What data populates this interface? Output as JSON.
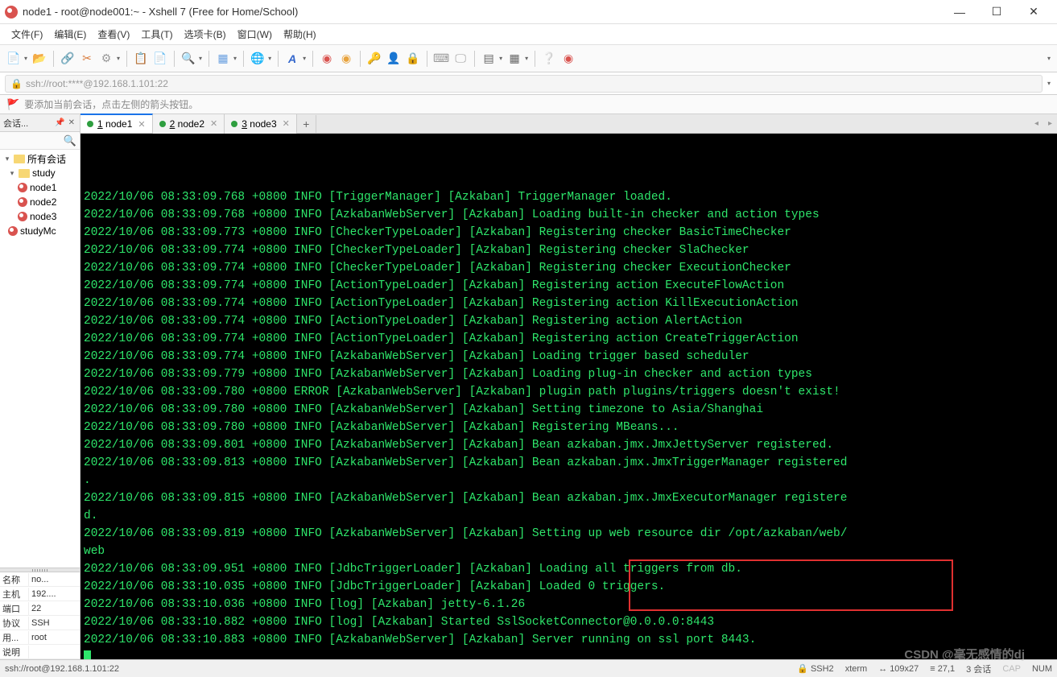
{
  "window": {
    "title": "node1 - root@node001:~ - Xshell 7 (Free for Home/School)"
  },
  "menu": {
    "file": "文件(F)",
    "edit": "编辑(E)",
    "view": "查看(V)",
    "tools": "工具(T)",
    "tabs": "选项卡(B)",
    "window": "窗口(W)",
    "help": "帮助(H)"
  },
  "address": {
    "url": "ssh://root:****@192.168.1.101:22"
  },
  "hint": {
    "text": "要添加当前会话，点击左侧的箭头按钮。"
  },
  "sidepanel": {
    "title": "会话...",
    "tree": {
      "root": "所有会话",
      "folder": "study",
      "items": [
        "node1",
        "node2",
        "node3"
      ],
      "extra": "studyMc"
    },
    "props": {
      "name_k": "名称",
      "name_v": "no...",
      "host_k": "主机",
      "host_v": "192....",
      "port_k": "端口",
      "port_v": "22",
      "proto_k": "协议",
      "proto_v": "SSH",
      "user_k": "用...",
      "user_v": "root",
      "desc_k": "说明",
      "desc_v": ""
    }
  },
  "tabs": [
    {
      "num": "1",
      "label": "node1",
      "active": true
    },
    {
      "num": "2",
      "label": "node2",
      "active": false
    },
    {
      "num": "3",
      "label": "node3",
      "active": false
    }
  ],
  "terminal": {
    "lines": [
      "2022/10/06 08:33:09.768 +0800 INFO [TriggerManager] [Azkaban] TriggerManager loaded.",
      "2022/10/06 08:33:09.768 +0800 INFO [AzkabanWebServer] [Azkaban] Loading built-in checker and action types",
      "2022/10/06 08:33:09.773 +0800 INFO [CheckerTypeLoader] [Azkaban] Registering checker BasicTimeChecker",
      "2022/10/06 08:33:09.774 +0800 INFO [CheckerTypeLoader] [Azkaban] Registering checker SlaChecker",
      "2022/10/06 08:33:09.774 +0800 INFO [CheckerTypeLoader] [Azkaban] Registering checker ExecutionChecker",
      "2022/10/06 08:33:09.774 +0800 INFO [ActionTypeLoader] [Azkaban] Registering action ExecuteFlowAction",
      "2022/10/06 08:33:09.774 +0800 INFO [ActionTypeLoader] [Azkaban] Registering action KillExecutionAction",
      "2022/10/06 08:33:09.774 +0800 INFO [ActionTypeLoader] [Azkaban] Registering action AlertAction",
      "2022/10/06 08:33:09.774 +0800 INFO [ActionTypeLoader] [Azkaban] Registering action CreateTriggerAction",
      "2022/10/06 08:33:09.774 +0800 INFO [AzkabanWebServer] [Azkaban] Loading trigger based scheduler",
      "2022/10/06 08:33:09.779 +0800 INFO [AzkabanWebServer] [Azkaban] Loading plug-in checker and action types",
      "2022/10/06 08:33:09.780 +0800 ERROR [AzkabanWebServer] [Azkaban] plugin path plugins/triggers doesn't exist!",
      "2022/10/06 08:33:09.780 +0800 INFO [AzkabanWebServer] [Azkaban] Setting timezone to Asia/Shanghai",
      "2022/10/06 08:33:09.780 +0800 INFO [AzkabanWebServer] [Azkaban] Registering MBeans...",
      "2022/10/06 08:33:09.801 +0800 INFO [AzkabanWebServer] [Azkaban] Bean azkaban.jmx.JmxJettyServer registered.",
      "2022/10/06 08:33:09.813 +0800 INFO [AzkabanWebServer] [Azkaban] Bean azkaban.jmx.JmxTriggerManager registered",
      ".",
      "2022/10/06 08:33:09.815 +0800 INFO [AzkabanWebServer] [Azkaban] Bean azkaban.jmx.JmxExecutorManager registere",
      "d.",
      "2022/10/06 08:33:09.819 +0800 INFO [AzkabanWebServer] [Azkaban] Setting up web resource dir /opt/azkaban/web/",
      "web",
      "2022/10/06 08:33:09.951 +0800 INFO [JdbcTriggerLoader] [Azkaban] Loading all triggers from db.",
      "2022/10/06 08:33:10.035 +0800 INFO [JdbcTriggerLoader] [Azkaban] Loaded 0 triggers.",
      "2022/10/06 08:33:10.036 +0800 INFO [log] [Azkaban] jetty-6.1.26",
      "2022/10/06 08:33:10.882 +0800 INFO [log] [Azkaban] Started SslSocketConnector@0.0.0.0:8443",
      "2022/10/06 08:33:10.883 +0800 INFO [AzkabanWebServer] [Azkaban] Server running on ssl port 8443."
    ]
  },
  "statusbar": {
    "conn": "ssh://root@192.168.1.101:22",
    "proto": "SSH2",
    "term": "xterm",
    "size": "109x27",
    "pos": "27,1",
    "sessions": "3 会话",
    "cap": "CAP",
    "num": "NUM"
  },
  "watermark": "CSDN @毫无感情的dj"
}
